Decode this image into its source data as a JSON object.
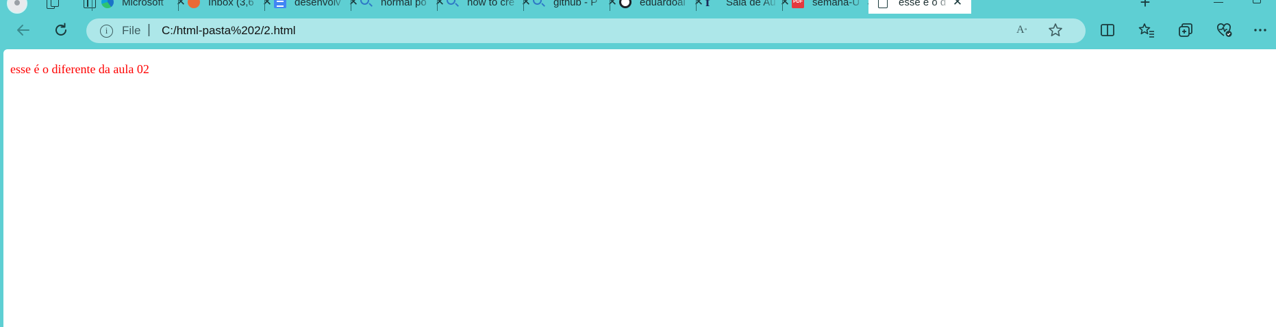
{
  "browser": {
    "tabs": [
      {
        "title": "Microsoft",
        "favicon": "edge-icon"
      },
      {
        "title": "Inbox (3,6",
        "favicon": "mail-icon"
      },
      {
        "title": "desenvolv",
        "favicon": "docs-icon"
      },
      {
        "title": "normal po",
        "favicon": "search-icon"
      },
      {
        "title": "how to cre",
        "favicon": "search-icon"
      },
      {
        "title": "github - P",
        "favicon": "search-icon"
      },
      {
        "title": "eduardoal",
        "favicon": "github-icon"
      },
      {
        "title": "Sala de Au",
        "favicon": "f-icon"
      },
      {
        "title": "semana-U",
        "favicon": "pdf-icon"
      },
      {
        "title": "esse é o d",
        "favicon": "page-icon",
        "active": true
      }
    ],
    "address_bar": {
      "scheme_label": "File",
      "divider": "|",
      "url": "C:/html-pasta%202/2.html"
    },
    "colors": {
      "frame": "#5ecfd3",
      "address_bg": "#ade7e9",
      "page_text": "#ff0000"
    }
  },
  "page": {
    "text": "esse é o diferente da aula 02"
  }
}
